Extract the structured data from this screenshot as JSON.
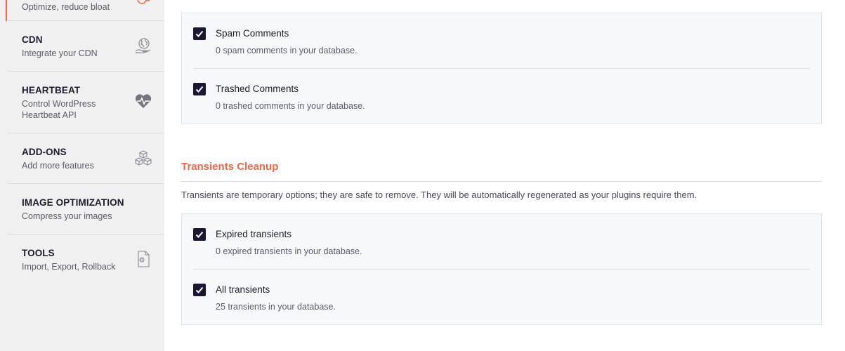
{
  "sidebar": {
    "items": [
      {
        "desc": "Optimize, reduce bloat",
        "icon": "database-cleanup-icon"
      },
      {
        "title": "CDN",
        "desc": "Integrate your CDN",
        "icon": "globe-hand-icon"
      },
      {
        "title": "HEARTBEAT",
        "desc": "Control WordPress Heartbeat API",
        "icon": "heartbeat-icon"
      },
      {
        "title": "ADD-ONS",
        "desc": "Add more features",
        "icon": "cubes-icon"
      },
      {
        "title": "IMAGE OPTIMIZATION",
        "desc": "Compress your images"
      },
      {
        "title": "TOOLS",
        "desc": "Import, Export, Rollback",
        "icon": "tools-file-gear-icon"
      }
    ]
  },
  "comments_panel": {
    "options": [
      {
        "label": "Spam Comments",
        "detail": "0 spam comments in your database.",
        "checked": true
      },
      {
        "label": "Trashed Comments",
        "detail": "0 trashed comments in your database.",
        "checked": true
      }
    ]
  },
  "transients": {
    "title": "Transients Cleanup",
    "description": "Transients are temporary options; they are safe to remove. They will be automatically regenerated as your plugins require them.",
    "options": [
      {
        "label": "Expired transients",
        "detail": "0 expired transients in your database.",
        "checked": true
      },
      {
        "label": "All transients",
        "detail": "25 transients in your database.",
        "checked": true
      }
    ]
  },
  "colors": {
    "accent": "#f56640",
    "checkbox": "#1d1534",
    "sidebar_bg": "#f0f0f1"
  }
}
